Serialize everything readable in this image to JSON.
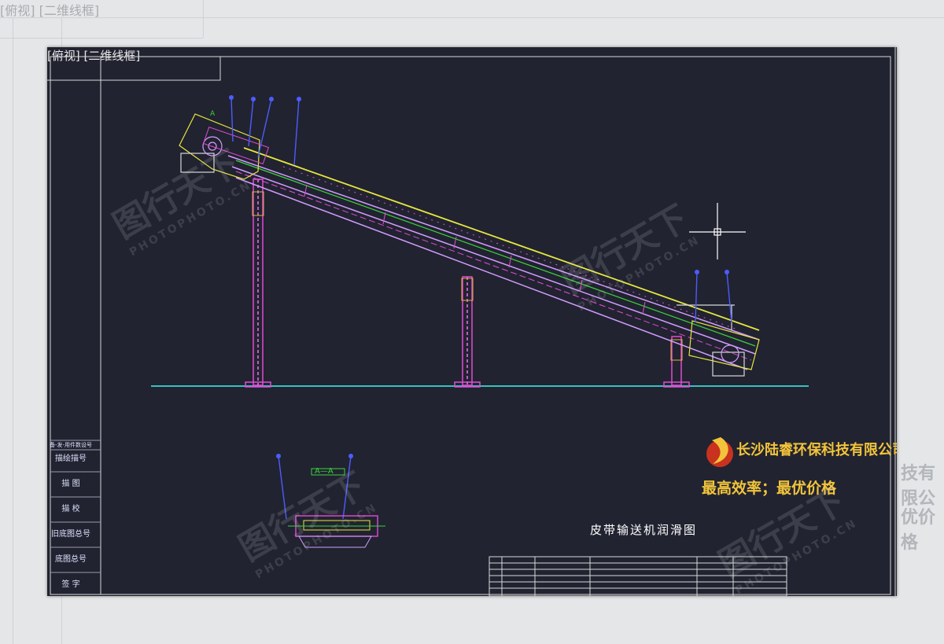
{
  "viewport": {
    "label": "[俯视] [二维线框]",
    "background": "#212330"
  },
  "background_window": {
    "label": "[俯视] [二维线框]",
    "ghost_company": "技有限公",
    "ghost_slogan": "优价格"
  },
  "title_block": {
    "header": "备-发-用件数设号",
    "rows": [
      "描绘描号",
      "描 图",
      "描 校",
      "旧底图总号",
      "底图总号",
      "签 字"
    ]
  },
  "company": {
    "name": "长沙陆睿环保科技有限公司",
    "slogan": "最高效率；最优价格",
    "logo_color": "#c8321e",
    "text_color": "#f2c43b"
  },
  "drawing": {
    "title": "皮带输送机润滑图",
    "section_label": "A—A",
    "detail_label": "A"
  },
  "watermark": {
    "text": "图行天下",
    "sub": "PHOTOPHOTO.CN"
  },
  "colors": {
    "frame": "#d8d8d8",
    "conveyor": "#d39cff",
    "belt": "#e6e640",
    "support": "#e24bd6",
    "ground": "#39c0c0",
    "leader": "#4c5cff",
    "green": "#3cd33c"
  }
}
